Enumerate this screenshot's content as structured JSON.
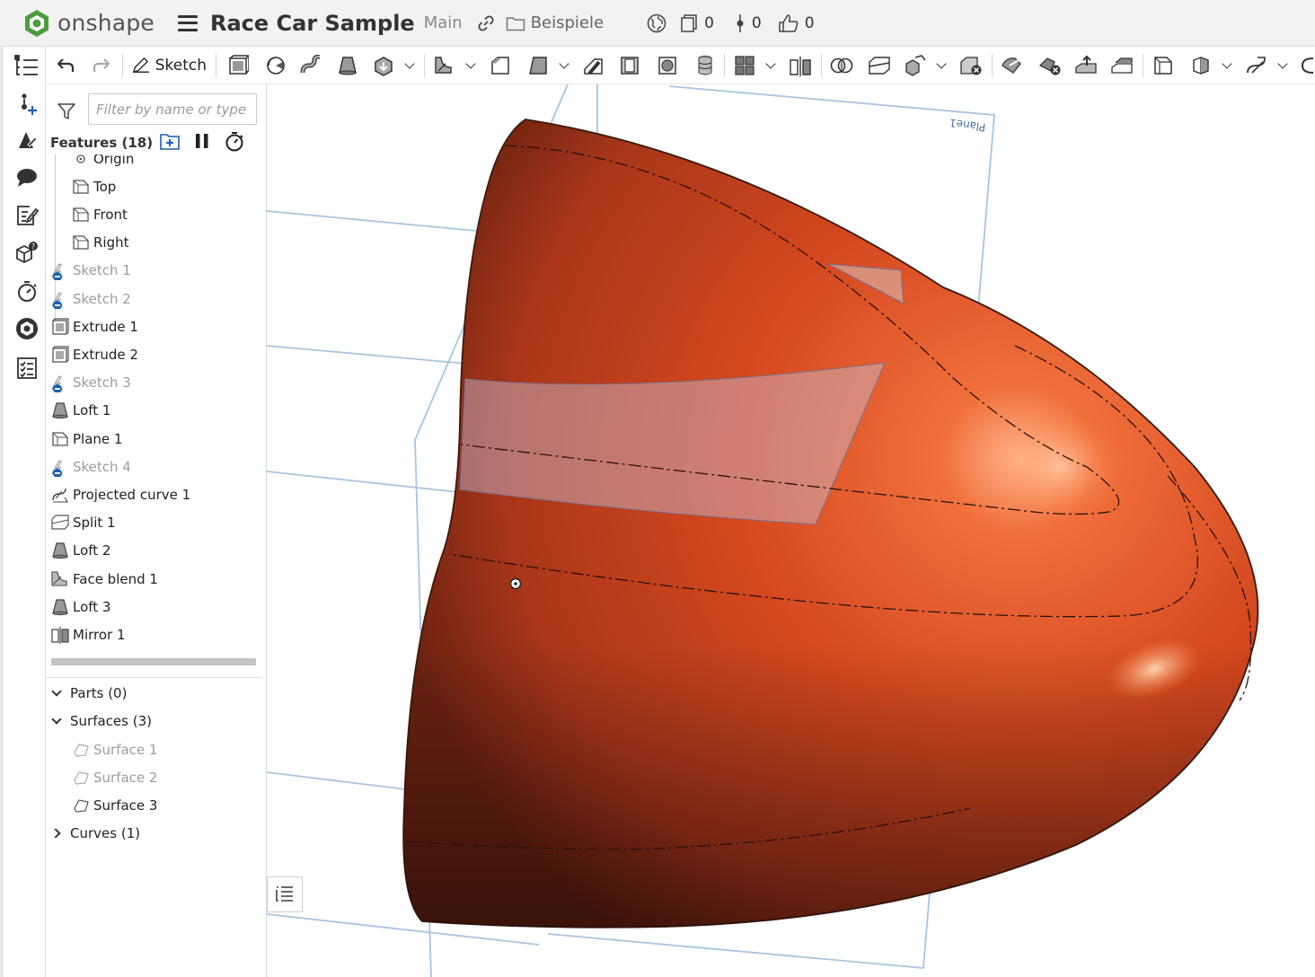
{
  "header": {
    "logo_text": "onshape",
    "doc_title": "Race Car Sample",
    "branch": "Main",
    "folder": "Beispiele",
    "stats": {
      "versions": "0",
      "branches": "0",
      "likes": "0"
    }
  },
  "toolbar": {
    "sketch_label": "Sketch"
  },
  "panel": {
    "filter_placeholder": "Filter by name or type",
    "features_header": "Features (18)",
    "tree": [
      {
        "label": "Origin",
        "icon": "origin-icon",
        "dim": false,
        "indent": true
      },
      {
        "label": "Top",
        "icon": "plane-icon",
        "dim": false,
        "indent": true
      },
      {
        "label": "Front",
        "icon": "plane-icon",
        "dim": false,
        "indent": true
      },
      {
        "label": "Right",
        "icon": "plane-icon",
        "dim": false,
        "indent": true
      },
      {
        "label": "Sketch 1",
        "icon": "sketch-icon",
        "dim": true,
        "indent": false
      },
      {
        "label": "Sketch 2",
        "icon": "sketch-icon",
        "dim": true,
        "indent": false
      },
      {
        "label": "Extrude 1",
        "icon": "extrude-icon",
        "dim": false,
        "indent": false
      },
      {
        "label": "Extrude 2",
        "icon": "extrude-icon",
        "dim": false,
        "indent": false
      },
      {
        "label": "Sketch 3",
        "icon": "sketch-icon",
        "dim": true,
        "indent": false
      },
      {
        "label": "Loft 1",
        "icon": "loft-icon",
        "dim": false,
        "indent": false
      },
      {
        "label": "Plane 1",
        "icon": "plane-icon",
        "dim": false,
        "indent": false
      },
      {
        "label": "Sketch 4",
        "icon": "sketch-icon",
        "dim": true,
        "indent": false
      },
      {
        "label": "Projected curve 1",
        "icon": "projected-curve-icon",
        "dim": false,
        "indent": false
      },
      {
        "label": "Split 1",
        "icon": "split-icon",
        "dim": false,
        "indent": false
      },
      {
        "label": "Loft 2",
        "icon": "loft-icon",
        "dim": false,
        "indent": false
      },
      {
        "label": "Face blend 1",
        "icon": "face-blend-icon",
        "dim": false,
        "indent": false
      },
      {
        "label": "Loft 3",
        "icon": "loft-icon",
        "dim": false,
        "indent": false
      },
      {
        "label": "Mirror 1",
        "icon": "mirror-icon",
        "dim": false,
        "indent": false
      }
    ],
    "sections": {
      "parts": "Parts (0)",
      "surfaces": "Surfaces (3)",
      "surface_items": [
        {
          "label": "Surface 1",
          "dim": true
        },
        {
          "label": "Surface 2",
          "dim": true
        },
        {
          "label": "Surface 3",
          "dim": false
        }
      ],
      "curves": "Curves (1)"
    }
  },
  "viewport": {
    "plane_label": "Plane1",
    "body_color": "#d94e26"
  },
  "colors": {
    "accent": "#1a5fb4",
    "logo_green": "#4c9b3f",
    "plane_edge": "#8eb2d6"
  }
}
